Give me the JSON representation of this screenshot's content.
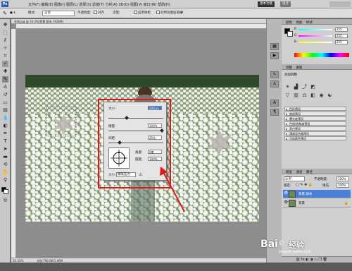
{
  "menubar": {
    "logo": "Ps",
    "menu_text": "文件(F) 编辑(E) 图像(I) 图层(L) 选择(S) 滤镜(T) 分析(A) 3D(D) 视图(V) 窗口(W) 帮助(H)",
    "workspace_primary": "基本功能",
    "workspace_secondary": "设计"
  },
  "optbar": {
    "mode_label": "模式:",
    "mode_value": "正常",
    "opacity_label": "不透明度:",
    "opacity_value": "100%",
    "flow_label": "流量:",
    "flow_value": "100%",
    "airbrush_label": "启用喷枪",
    "sample_all_label": "对所有图层取样",
    "aligned_label": "对齐"
  },
  "document": {
    "tab_title": "花海.jpg @ 33.3%(背景 副本, RGB/8)",
    "zoom": "33.33%",
    "doc_size": "文档:790.6K/1.46M"
  },
  "dialog": {
    "size_label": "大小:",
    "size_value": "200 px",
    "hardness_label": "硬度:",
    "hardness_value": "100%",
    "spacing_label": "间距:",
    "spacing_value": "25%",
    "angle_label": "角度:",
    "angle_value": "0度",
    "roundness_label": "圆度:",
    "roundness_value": "100%",
    "size_control_label": "大小:",
    "size_control_value": "钢笔压力",
    "icon_note": "⚠"
  },
  "color_panel": {
    "tabs": [
      "颜色",
      "色板",
      "样式"
    ],
    "r_label": "R",
    "r_value": "255",
    "g_label": "G",
    "g_value": "255",
    "b_label": "B",
    "b_value": "255",
    "fg_color": "#000000",
    "bg_color": "#ffffff"
  },
  "adjust_panel": {
    "tabs": [
      "调整",
      "蒙版"
    ],
    "title": "添加调整",
    "presets": [
      "色阶预设",
      "曲线预设",
      "曝光度预设",
      "色相/饱和度预设",
      "黑白预设",
      "通道混合器预设",
      "可选颜色预设"
    ]
  },
  "layers_panel": {
    "tabs": [
      "图层",
      "通道",
      "路径"
    ],
    "blend_mode": "正常",
    "opacity_label": "不透明度:",
    "opacity_value": "100%",
    "lock_label": "锁定:",
    "fill_label": "填充:",
    "fill_value": "100%",
    "layers": [
      {
        "name": "背景 副本",
        "active": true
      },
      {
        "name": "背景",
        "active": false
      }
    ]
  },
  "watermark": {
    "brand": "Bai",
    "brand_suffix": "经验",
    "url": "jingyan.baidu.com"
  },
  "colors": {
    "highlight": "#e01818",
    "selected_layer": "#4a7fd8"
  }
}
